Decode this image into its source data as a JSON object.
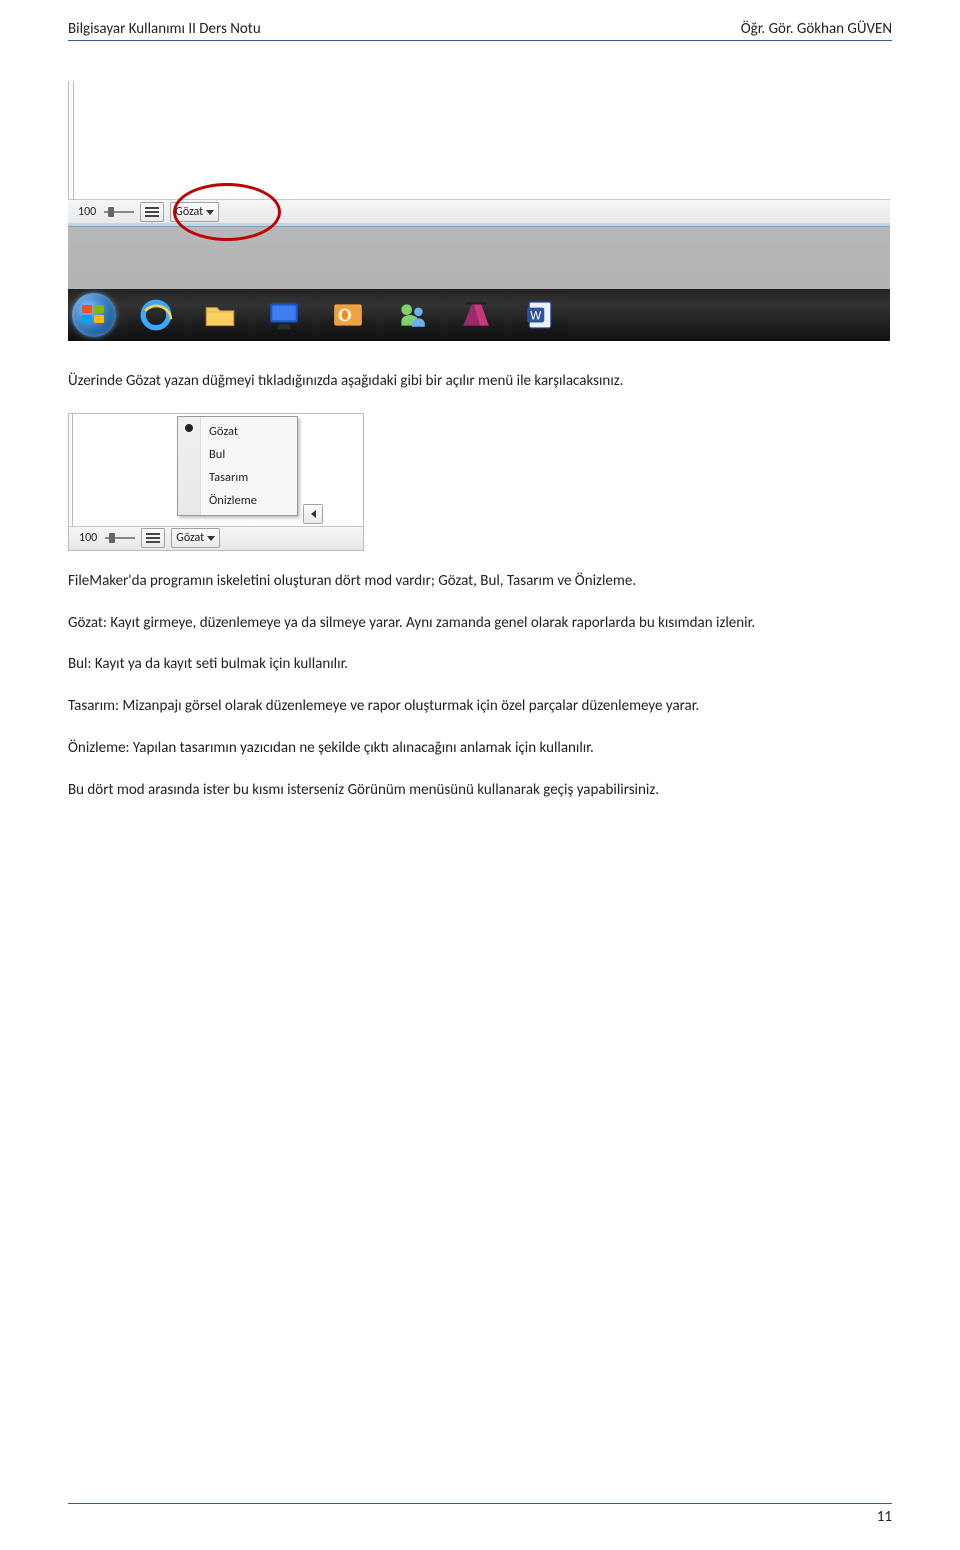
{
  "header": {
    "left": "Bilgisayar Kullanımı II Ders Notu",
    "right": "Öğr. Gör. Gökhan GÜVEN"
  },
  "statusbar1": {
    "zoom": "100",
    "mode_label": "Gözat"
  },
  "taskbar_icons": [
    "start",
    "ie",
    "explorer",
    "media-center",
    "outlook",
    "messenger",
    "filemaker",
    "word"
  ],
  "para1": "Üzerinde Gözat yazan düğmeyi tıkladığınızda aşağıdaki gibi bir açılır menü ile karşılacaksınız.",
  "popup": {
    "items": [
      "Gözat",
      "Bul",
      "Tasarım",
      "Önizleme"
    ],
    "selected": "Gözat"
  },
  "statusbar2": {
    "zoom": "100",
    "mode_label": "Gözat"
  },
  "body_paragraphs": [
    "FileMaker'da programın iskeletini oluşturan dört mod vardır; Gözat, Bul, Tasarım ve Önizleme.",
    "Gözat: Kayıt girmeye, düzenlemeye ya da silmeye yarar. Aynı zamanda genel olarak raporlarda bu kısımdan izlenir.",
    "Bul: Kayıt ya da kayıt seti bulmak için kullanılır.",
    "Tasarım: Mizanpajı görsel olarak düzenlemeye ve rapor oluşturmak için özel parçalar düzenlemeye yarar.",
    "Önizleme: Yapılan tasarımın yazıcıdan ne şekilde çıktı alınacağını anlamak için kullanılır.",
    "Bu dört mod arasında ister bu kısmı isterseniz Görünüm menüsünü kullanarak geçiş yapabilirsiniz."
  ],
  "page_number": "11"
}
